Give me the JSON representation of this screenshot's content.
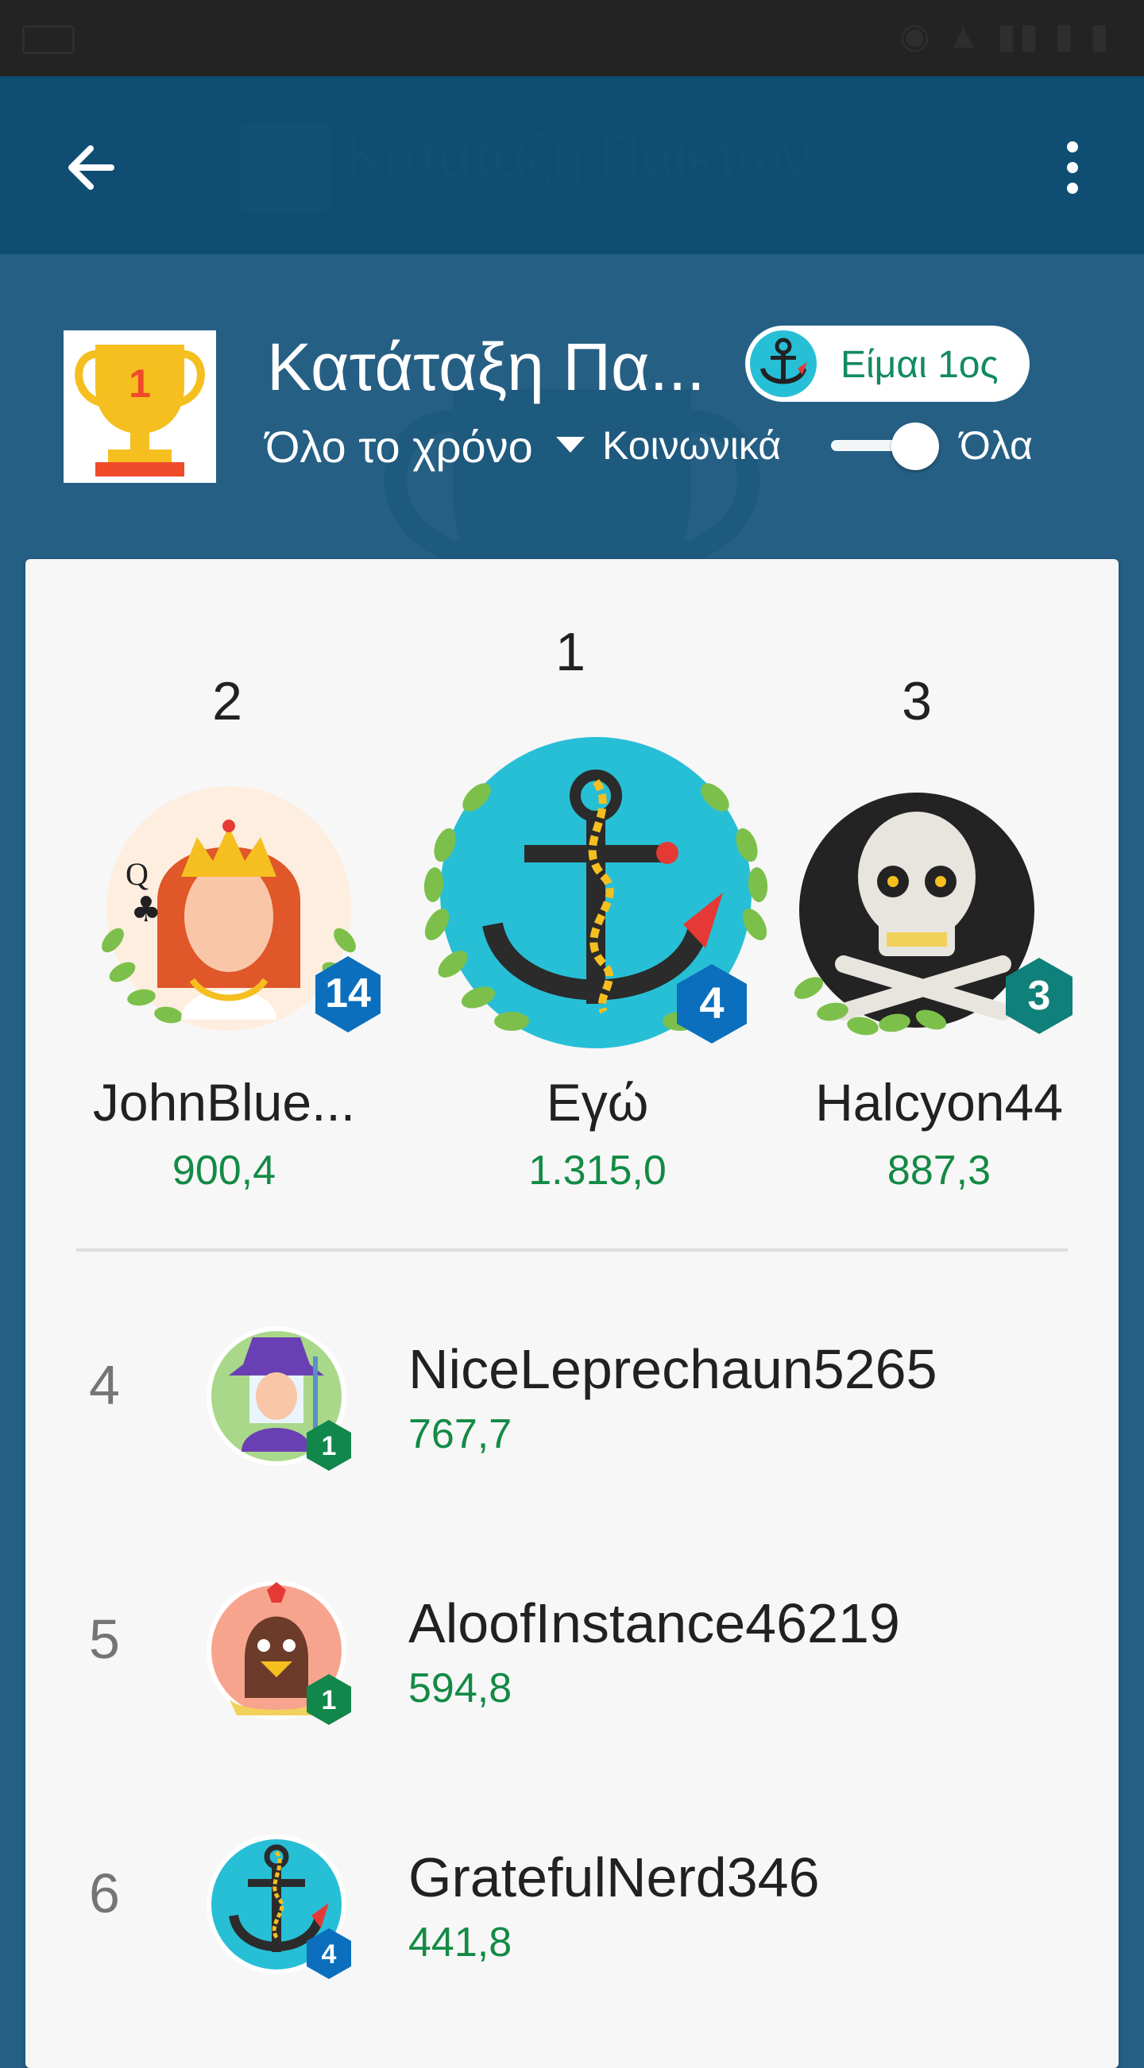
{
  "app_bar": {
    "title": "Κατάταξη Παικτών",
    "back_icon": "arrow-left-icon",
    "menu_icon": "more-vert-icon"
  },
  "header": {
    "title": "Κατάταξη Πα...",
    "trophy_rank": "1",
    "me_first_label": "Είμαι 1ος",
    "period": "Όλο το χρόνο",
    "social_label": "Κοινωνικά",
    "all_label": "Όλα",
    "toggle_on": true
  },
  "podium": [
    {
      "rank": "2",
      "name": "JohnBlue...",
      "score": "900,4",
      "level": "14",
      "avatar": "queen-of-clubs"
    },
    {
      "rank": "1",
      "name": "Εγώ",
      "score": "1.315,0",
      "level": "4",
      "avatar": "anchor"
    },
    {
      "rank": "3",
      "name": "Halcyon44",
      "score": "887,3",
      "level": "3",
      "avatar": "skull"
    }
  ],
  "list": [
    {
      "rank": "4",
      "name": "NiceLeprechaun5265",
      "score": "767,7",
      "level": "1",
      "avatar": "wizard"
    },
    {
      "rank": "5",
      "name": "AloofInstance46219",
      "score": "594,8",
      "level": "1",
      "avatar": "rooster"
    },
    {
      "rank": "6",
      "name": "GratefulNerd346",
      "score": "441,8",
      "level": "4",
      "avatar": "anchor"
    }
  ],
  "colors": {
    "background": "#255f84",
    "app_bar": "#0f4d72",
    "score_green": "#138a45",
    "level_blue": "#0b6fbd",
    "level_teal": "#10807a",
    "level_green": "#11874b"
  }
}
